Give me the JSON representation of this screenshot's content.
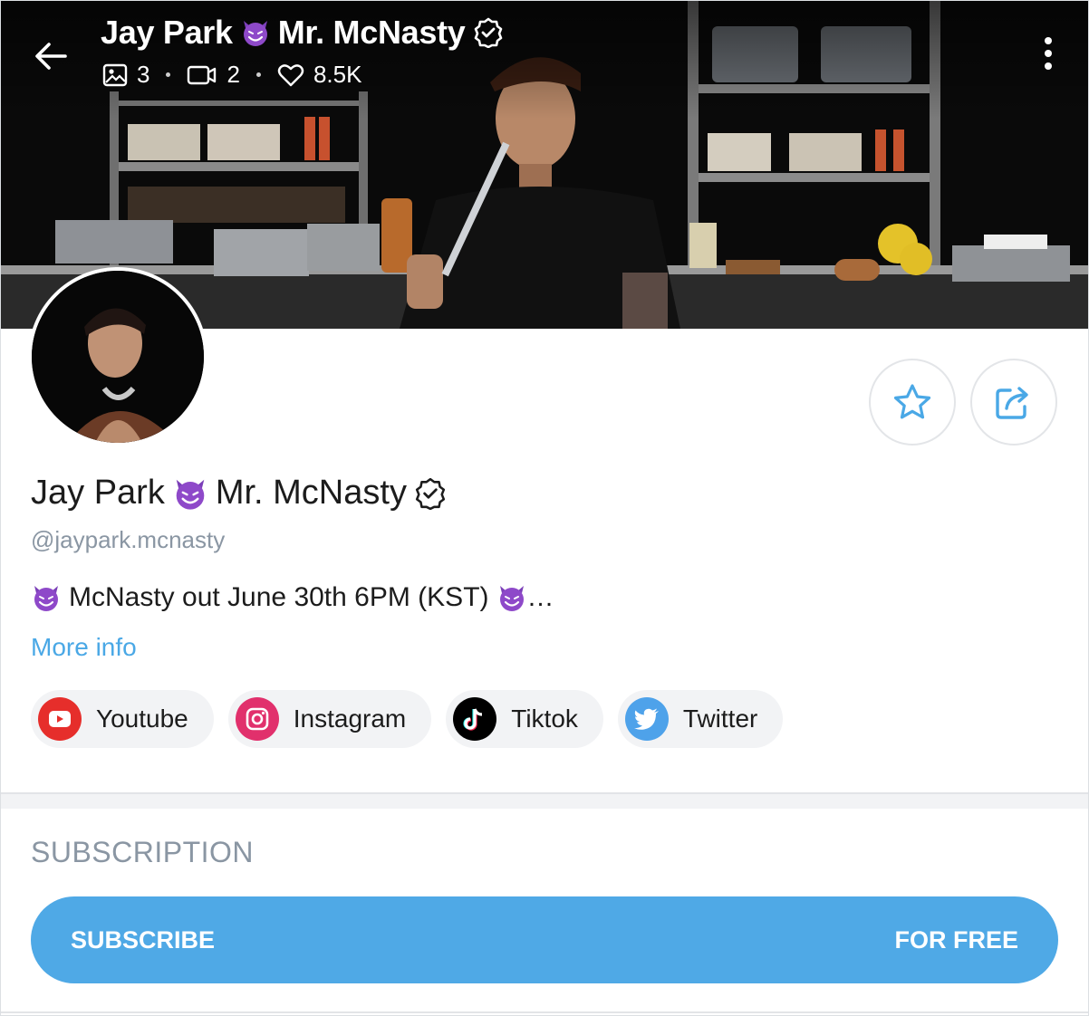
{
  "header": {
    "name": "Jay Park",
    "alias": "Mr. McNasty",
    "stats": {
      "photos": "3",
      "videos": "2",
      "likes": "8.5K"
    }
  },
  "profile": {
    "name": "Jay Park",
    "alias": "Mr. McNasty",
    "handle": "@jaypark.mcnasty",
    "bio": "McNasty out June 30th 6PM (KST)",
    "bio_suffix": "…",
    "more_info": "More info"
  },
  "socials": [
    {
      "label": "Youtube",
      "icon": "youtube-icon",
      "color": "#e62e2b"
    },
    {
      "label": "Instagram",
      "icon": "instagram-icon",
      "color": "#e1306c"
    },
    {
      "label": "Tiktok",
      "icon": "tiktok-icon",
      "color": "#000000"
    },
    {
      "label": "Twitter",
      "icon": "twitter-icon",
      "color": "#4ea2ea"
    }
  ],
  "subscription": {
    "heading": "SUBSCRIPTION",
    "button_label": "SUBSCRIBE",
    "price_label": "FOR FREE"
  },
  "colors": {
    "accent": "#4fa9e6",
    "muted": "#8a96a3",
    "devil": "#7b3fb8"
  }
}
